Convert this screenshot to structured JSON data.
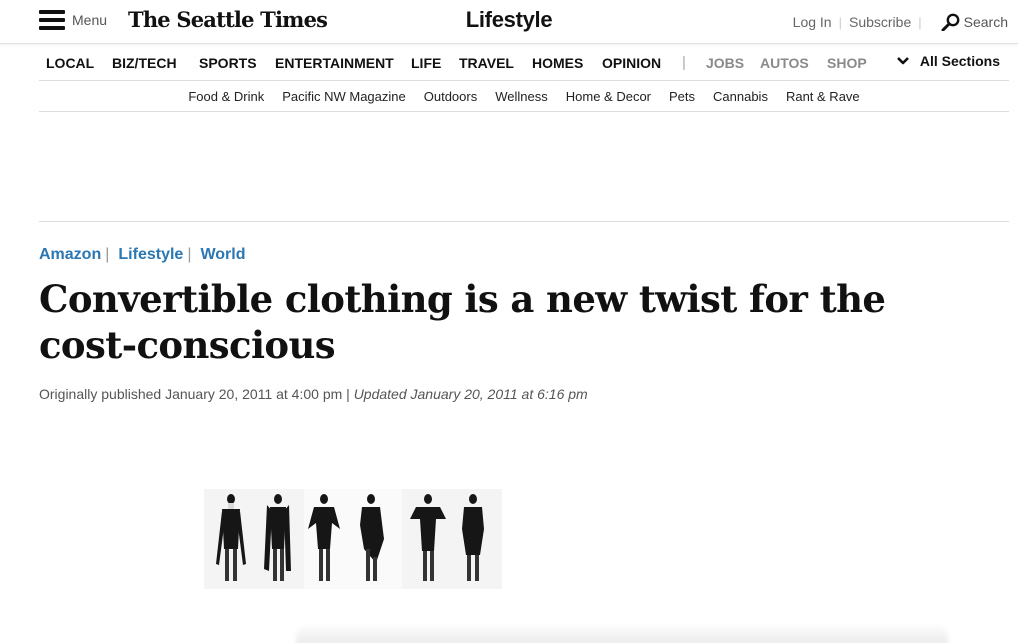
{
  "header": {
    "menu_label": "Menu",
    "logo_text": "The Seattle Times",
    "section_title": "Lifestyle",
    "login_label": "Log In",
    "subscribe_label": "Subscribe",
    "search_label": "Search"
  },
  "main_nav": {
    "items": [
      "Local",
      "Biz/Tech",
      "Sports",
      "Entertainment",
      "Life",
      "Travel",
      "Homes",
      "Opinion"
    ],
    "secondary_items": [
      "Jobs",
      "Autos",
      "Shop"
    ],
    "separator": "|",
    "all_sections_label": "All Sections"
  },
  "sub_nav": {
    "items": [
      "Food & Drink",
      "Pacific NW Magazine",
      "Outdoors",
      "Wellness",
      "Home & Decor",
      "Pets",
      "Cannabis",
      "Rant & Rave"
    ]
  },
  "article": {
    "tags": [
      "Amazon",
      "Lifestyle",
      "World"
    ],
    "headline": "Convertible clothing is a new twist for the cost-conscious",
    "published": "Originally published January 20, 2011 at 4:00 pm",
    "updated": "Updated January 20, 2011 at 6:16 pm",
    "date_separator": "|"
  },
  "photo": {
    "figure_count": 6
  },
  "colors": {
    "tag_blue": "#2a77b3",
    "nav_gray": "#8a8a8a",
    "text_dark": "#111111"
  }
}
